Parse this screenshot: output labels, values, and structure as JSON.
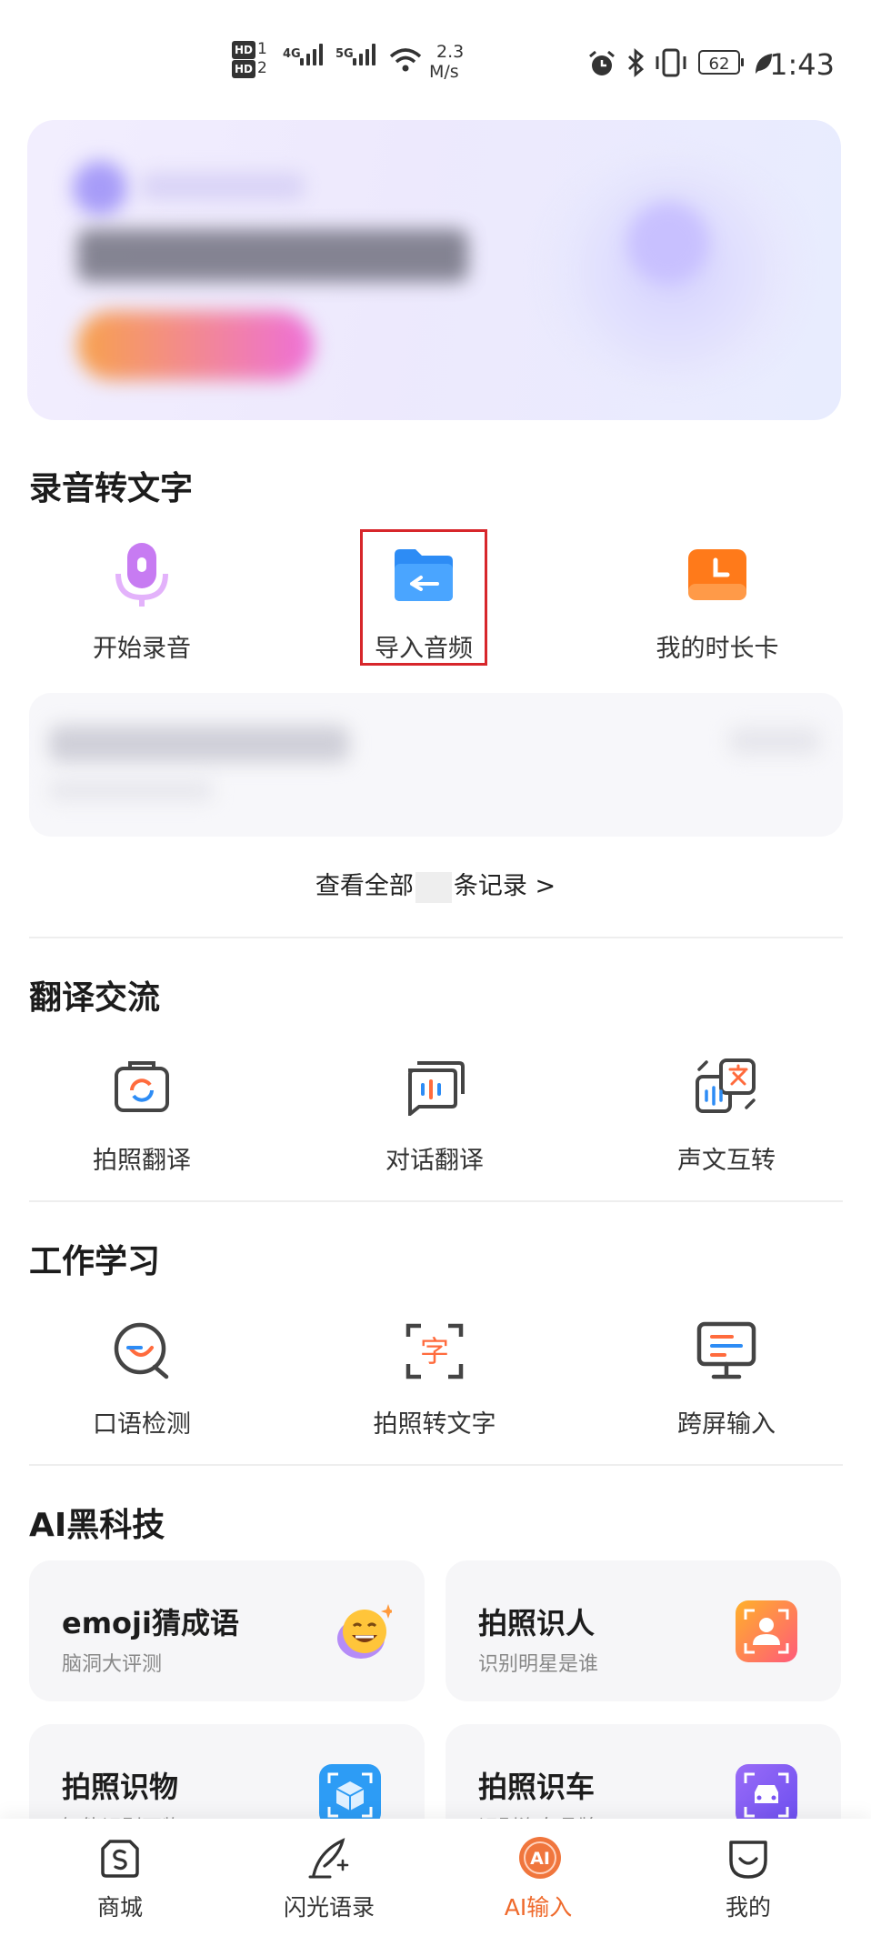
{
  "status_bar": {
    "hd1": "HD",
    "hd1_sub": "1",
    "hd2": "HD",
    "hd2_sub": "2",
    "net1": "4G",
    "net2": "5G",
    "speed_value": "2.3",
    "speed_unit": "M/s",
    "battery": "62",
    "time": "1:43"
  },
  "sections": {
    "record": {
      "title": "录音转文字",
      "items": [
        {
          "label": "开始录音",
          "icon": "microphone-icon"
        },
        {
          "label": "导入音频",
          "icon": "folder-import-icon"
        },
        {
          "label": "我的时长卡",
          "icon": "clock-icon"
        }
      ],
      "view_all_prefix": "查看全部",
      "view_all_suffix": "条记录",
      "view_all_arrow": ">"
    },
    "translate": {
      "title": "翻译交流",
      "items": [
        {
          "label": "拍照翻译",
          "icon": "camera-translate-icon"
        },
        {
          "label": "对话翻译",
          "icon": "chat-translate-icon"
        },
        {
          "label": "声文互转",
          "icon": "voice-text-swap-icon"
        }
      ]
    },
    "work": {
      "title": "工作学习",
      "items": [
        {
          "label": "口语检测",
          "icon": "speech-check-icon"
        },
        {
          "label": "拍照转文字",
          "icon": "scan-text-icon"
        },
        {
          "label": "跨屏输入",
          "icon": "monitor-input-icon"
        }
      ]
    },
    "ai": {
      "title": "AI黑科技",
      "cards": [
        {
          "title": "emoji猜成语",
          "subtitle": "脑洞大评测",
          "icon": "emoji-face-icon"
        },
        {
          "title": "拍照识人",
          "subtitle": "识别明星是谁",
          "icon": "person-id-icon"
        },
        {
          "title": "拍照识物",
          "subtitle": "智能识别万物",
          "icon": "cube-scan-icon"
        },
        {
          "title": "拍照识车",
          "subtitle": "识别汽车品牌",
          "icon": "car-scan-icon"
        }
      ]
    }
  },
  "tabbar": {
    "tabs": [
      {
        "label": "商城",
        "icon": "shop-bag-icon"
      },
      {
        "label": "闪光语录",
        "icon": "quill-icon"
      },
      {
        "label": "AI输入",
        "icon": "ai-input-icon",
        "active": true
      },
      {
        "label": "我的",
        "icon": "profile-face-icon"
      }
    ]
  },
  "colors": {
    "accent": "#ef6a2c",
    "highlight": "#d7262b",
    "mic": "#c77bf2",
    "folder": "#2d8cf5",
    "clock": "#ff7a1a"
  }
}
